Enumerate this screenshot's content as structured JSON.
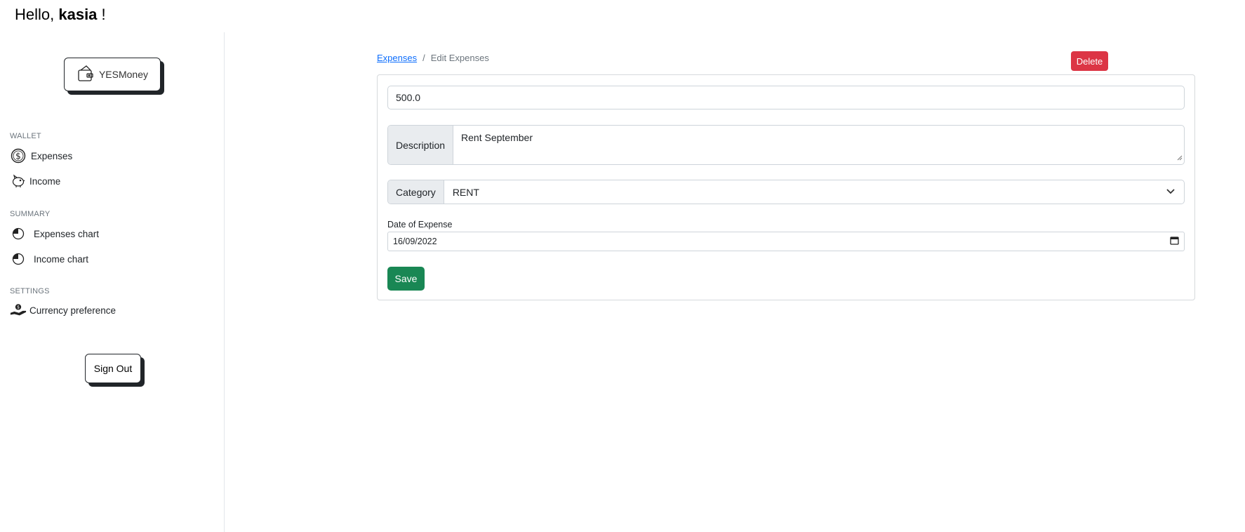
{
  "greeting": {
    "prefix": "Hello, ",
    "username": "kasia",
    "suffix": " !"
  },
  "sidebar": {
    "brand_label": "YESMoney",
    "sections": {
      "wallet": "WALLET",
      "summary": "SUMMARY",
      "settings": "SETTINGS"
    },
    "items": {
      "expenses": "Expenses",
      "income": "Income",
      "expenses_chart": "Expenses chart",
      "income_chart": "Income chart",
      "currency_preference": "Currency preference"
    },
    "signout_label": "Sign Out"
  },
  "breadcrumb": {
    "parent": "Expenses",
    "separator": "/",
    "current": "Edit Expenses"
  },
  "delete_label": "Delete",
  "form": {
    "amount_value": "500.0",
    "description_label": "Description",
    "description_value": "Rent September",
    "category_label": "Category",
    "category_value": "RENT",
    "date_label": "Date of Expense",
    "date_value": "16/09/2022",
    "save_label": "Save"
  },
  "colors": {
    "delete": "#dc3545",
    "save": "#198754",
    "link": "#0d6efd"
  }
}
